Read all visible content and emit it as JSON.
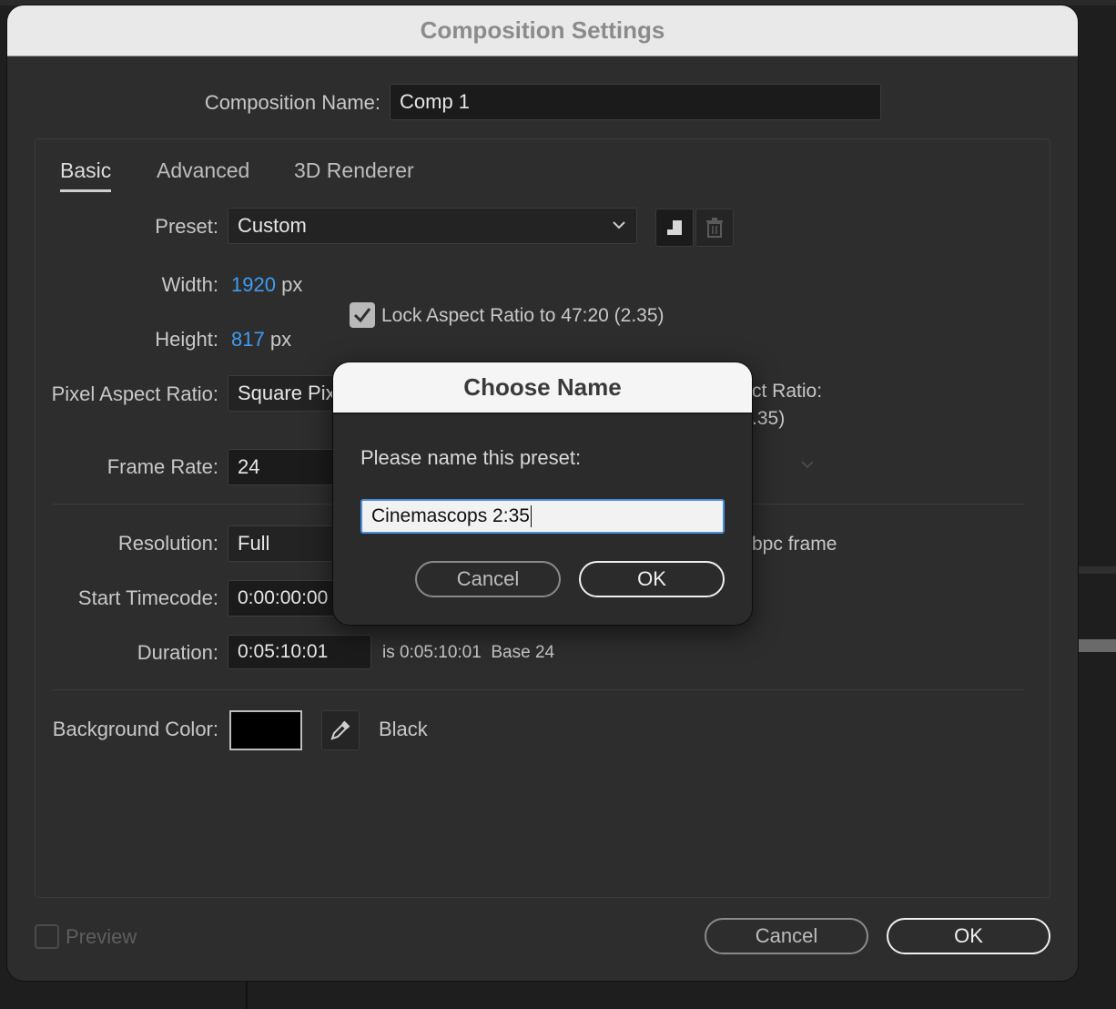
{
  "window": {
    "title": "Composition Settings"
  },
  "composition_name": {
    "label": "Composition Name:",
    "value": "Comp 1"
  },
  "tabs": [
    {
      "label": "Basic",
      "active": true
    },
    {
      "label": "Advanced",
      "active": false
    },
    {
      "label": "3D Renderer",
      "active": false
    }
  ],
  "preset": {
    "label": "Preset:",
    "value": "Custom"
  },
  "width": {
    "label": "Width:",
    "value": "1920",
    "unit": "px"
  },
  "height": {
    "label": "Height:",
    "value": "817",
    "unit": "px"
  },
  "lock_aspect": {
    "label": "Lock Aspect Ratio to 47:20 (2.35)",
    "checked": true
  },
  "pixel_aspect": {
    "label": "Pixel Aspect Ratio:",
    "value": "Square Pix",
    "side_label_1": "ct Ratio:",
    "side_label_2": ".35)"
  },
  "frame_rate": {
    "label": "Frame Rate:",
    "value": "24"
  },
  "resolution": {
    "label": "Resolution:",
    "value": "Full",
    "side_text": "bpc frame"
  },
  "start_timecode": {
    "label": "Start Timecode:",
    "value": "0:00:00:00"
  },
  "duration": {
    "label": "Duration:",
    "value": "0:05:10:01",
    "info": "is 0:05:10:01  Base 24"
  },
  "background_color": {
    "label": "Background Color:",
    "name": "Black",
    "swatch": "#000000"
  },
  "preview": {
    "label": "Preview",
    "checked": false
  },
  "footer": {
    "cancel": "Cancel",
    "ok": "OK"
  },
  "modal": {
    "title": "Choose Name",
    "prompt": "Please name this preset:",
    "input_value": "Cinemascops 2:35",
    "cancel": "Cancel",
    "ok": "OK"
  },
  "icons": {
    "new_preset": "save-preset-icon",
    "delete_preset": "trash-icon",
    "dropdown": "chevron-down-icon",
    "eyedropper": "eyedropper-icon",
    "check": "checkmark-icon"
  }
}
